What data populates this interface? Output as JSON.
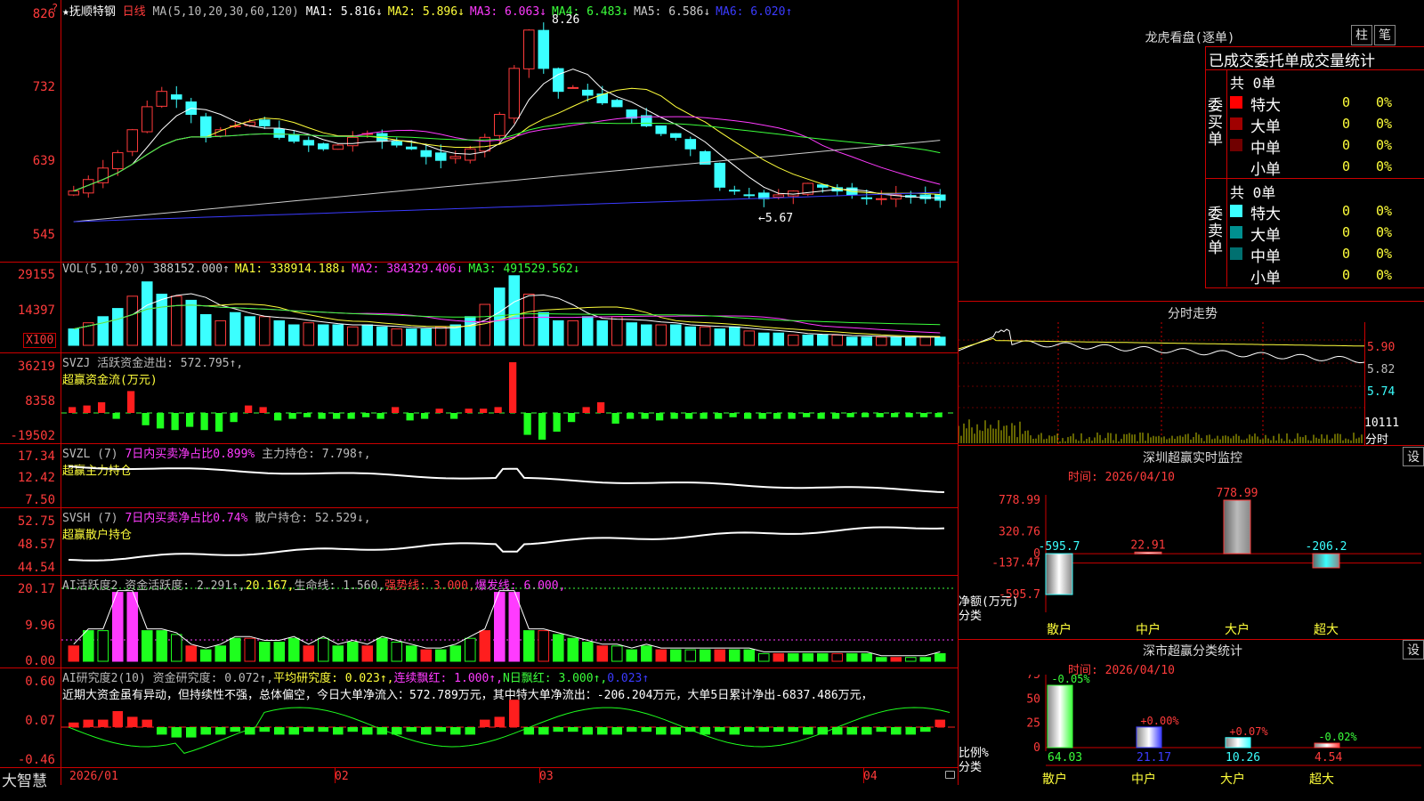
{
  "header": {
    "stock_name": "★抚顺特钢",
    "period": "日线",
    "ma_label": "MA(5,10,20,30,60,120)",
    "ma_values": [
      {
        "label": "MA1: 5.816↓",
        "color": "#ffffff"
      },
      {
        "label": "MA2: 5.896↓",
        "color": "#ffff3b"
      },
      {
        "label": "MA3: 6.063↓",
        "color": "#ff3bff"
      },
      {
        "label": "MA4: 6.483↓",
        "color": "#3bff3b"
      },
      {
        "label": "MA5: 6.586↓",
        "color": "#cccccc"
      },
      {
        "label": "MA6: 6.020↑",
        "color": "#3b3bff"
      }
    ],
    "high_mark": "8.26",
    "low_mark": "←5.67",
    "y_ticks": [
      "826",
      "732",
      "639",
      "545"
    ]
  },
  "vol": {
    "title": "VOL(5,10,20)",
    "vals": [
      {
        "label": "388152.000↑",
        "color": "#cccccc"
      },
      {
        "label": "MA1: 338914.188↓",
        "color": "#ffff3b"
      },
      {
        "label": "MA2: 384329.406↓",
        "color": "#ff3bff"
      },
      {
        "label": "MA3: 491529.562↓",
        "color": "#3bff3b"
      }
    ],
    "y_ticks": [
      "29155",
      "14397"
    ],
    "unit": "X100"
  },
  "svzj": {
    "title": "SVZJ  活跃资金进出: 572.795↑,",
    "sub": "超赢资金流(万元)",
    "y_ticks": [
      "36219",
      "8358",
      "-19502"
    ]
  },
  "svzl": {
    "title_a": "SVZL (7) ",
    "title_b": "7日内买卖净占比0.899%",
    "title_c": " 主力持仓: 7.798↑,",
    "sub": "超赢主力持仓",
    "y_ticks": [
      "17.34",
      "12.42",
      "7.50"
    ]
  },
  "svsh": {
    "title_a": "SVSH (7) ",
    "title_b": "7日内买卖净占比0.74%",
    "title_c": " 散户持仓: 52.529↓,",
    "sub": "超赢散户持仓",
    "y_ticks": [
      "52.75",
      "48.57",
      "44.54"
    ]
  },
  "ai1": {
    "title_a": "AI活跃度2 资金活跃度: 2.291↑,",
    "title_b": "20.167,",
    "title_c": "生命线: 1.560,",
    "title_d": "强势线: 3.000,",
    "title_e": "爆发线: 6.000,",
    "y_ticks": [
      "20.17",
      "9.96",
      "0.00"
    ]
  },
  "ai2": {
    "title_a": "AI研究度2(10) 资金研究度: 0.072↑,",
    "title_b": "平均研究度: 0.023↑,",
    "title_c": "连续飘红: 1.000↑,",
    "title_d": "N日飘红: 3.000↑,",
    "title_e": "0.023↑",
    "comment": "近期大资金虽有异动，但持续性不强，总体偏空，今日大单净流入：572.789万元，其中特大单净流出：-206.204万元，大单5日累计净出-6837.486万元，",
    "y_ticks": [
      "0.60",
      "0.07",
      "-0.46"
    ]
  },
  "xaxis": {
    "labels": [
      "2026/01",
      "02",
      "03",
      "04"
    ],
    "brand": "大智慧"
  },
  "dragon": {
    "title": "龙虎看盘(逐单)",
    "btn1": "柱",
    "btn2": "笔",
    "subtitle": "已成交委托单成交量统计",
    "buy_label": "委买单",
    "sell_label": "委卖单",
    "buy_total": "共 0单",
    "sell_total": "共 0单",
    "buy_rows": [
      {
        "label": "特大",
        "val": "0",
        "pct": "0%",
        "color": "#ff0000"
      },
      {
        "label": "大单",
        "val": "0",
        "pct": "0%",
        "color": "#a00000"
      },
      {
        "label": "中单",
        "val": "0",
        "pct": "0%",
        "color": "#700000"
      },
      {
        "label": "小单",
        "val": "0",
        "pct": "0%",
        "color": ""
      }
    ],
    "sell_rows": [
      {
        "label": "特大",
        "val": "0",
        "pct": "0%",
        "color": "#3bffff"
      },
      {
        "label": "大单",
        "val": "0",
        "pct": "0%",
        "color": "#009090"
      },
      {
        "label": "中单",
        "val": "0",
        "pct": "0%",
        "color": "#007070"
      },
      {
        "label": "小单",
        "val": "0",
        "pct": "0%",
        "color": ""
      }
    ]
  },
  "fenshi": {
    "title": "分时走势",
    "ticks": [
      "5.90",
      "5.82",
      "5.74"
    ],
    "vol_tick": "10111",
    "unit": "分时"
  },
  "sz": {
    "title": "深圳超赢实时监控",
    "btn": "设",
    "date": "时间: 2026/04/10",
    "y_ticks": [
      "778.99",
      "320.76",
      "0",
      "-137.47",
      "-595.7"
    ],
    "y_label": "净额(万元)",
    "x_label": "分类"
  },
  "shc": {
    "title": "深市超赢分类统计",
    "btn": "设",
    "date": "时间: 2026/04/10",
    "y_ticks": [
      "75",
      "50",
      "25",
      "0"
    ],
    "y_label": "比例%",
    "x_label": "分类"
  },
  "chart_data": [
    {
      "type": "candlestick",
      "title": "抚顺特钢 日线",
      "ylim": [
        5.45,
        8.26
      ],
      "high": 8.26,
      "low": 5.67
    },
    {
      "type": "bar",
      "title": "深圳超赢实时监控",
      "categories": [
        "散户",
        "中户",
        "大户",
        "超大"
      ],
      "values": [
        -595.7,
        22.91,
        778.99,
        -206.2
      ],
      "ylim": [
        -595.7,
        778.99
      ]
    },
    {
      "type": "bar",
      "title": "深市超赢分类统计",
      "categories": [
        "散户",
        "中户",
        "大户",
        "超大"
      ],
      "values": [
        64.03,
        21.17,
        10.26,
        4.54
      ],
      "changes": [
        "-0.05%",
        "+0.00%",
        "+0.07%",
        "-0.02%"
      ],
      "ylim": [
        0,
        75
      ]
    }
  ]
}
